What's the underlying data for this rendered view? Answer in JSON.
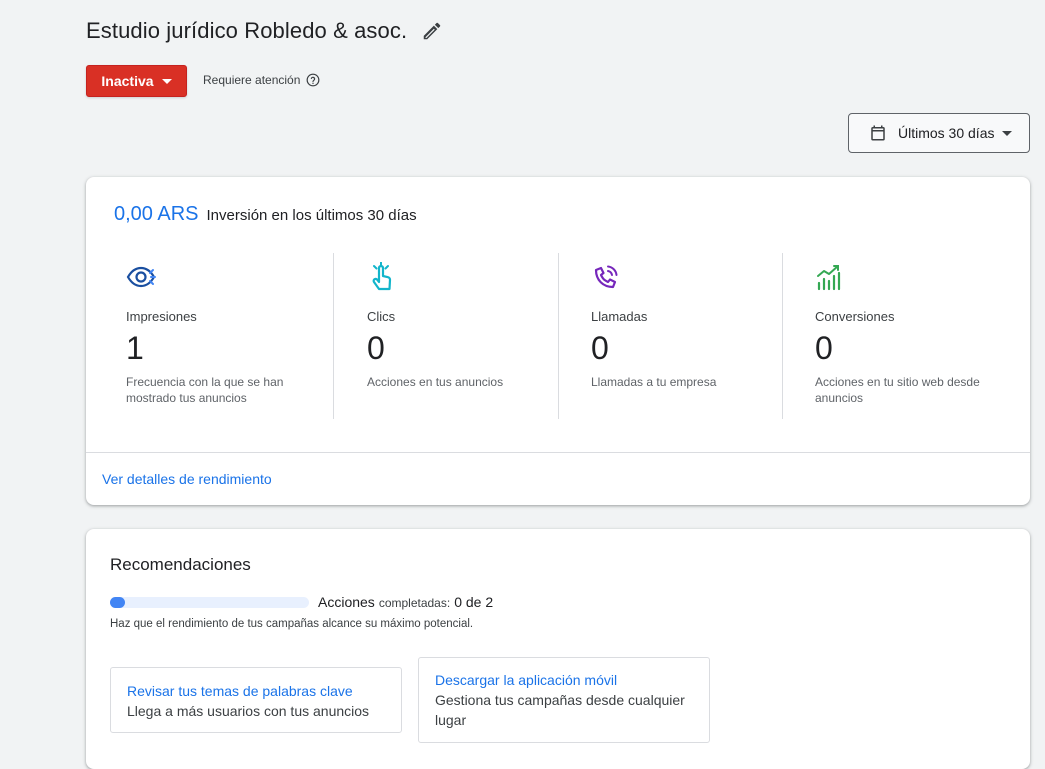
{
  "header": {
    "title": "Estudio jurídico Robledo & asoc.",
    "status_label": "Inactiva",
    "attention_text": "Requiere atención",
    "date_range_label": "Últimos 30 días"
  },
  "performance": {
    "spend_amount": "0,00 ARS",
    "spend_label": "Inversión en los últimos 30 días",
    "metrics": [
      {
        "icon": "eye-icon",
        "label": "Impresiones",
        "value": "1",
        "desc": "Frecuencia con la que se han mostrado tus anuncios",
        "color": "#1a4fa0"
      },
      {
        "icon": "tap-icon",
        "label": "Clics",
        "value": "0",
        "desc": "Acciones en tus anuncios",
        "color": "#12b5cb"
      },
      {
        "icon": "phone-call-icon",
        "label": "Llamadas",
        "value": "0",
        "desc": "Llamadas a tu empresa",
        "color": "#7627bb"
      },
      {
        "icon": "trend-chart-icon",
        "label": "Conversiones",
        "value": "0",
        "desc": "Acciones en tu sitio web desde anuncios",
        "color": "#34a853"
      }
    ],
    "details_link": "Ver detalles de rendimiento"
  },
  "recommendations": {
    "title": "Recomendaciones",
    "progress_fraction": 0.0,
    "progress_label_main": "Acciones",
    "progress_label_small": "completadas:",
    "progress_count": "0 de 2",
    "subtitle": "Haz que el rendimiento de tus campañas alcance su máximo potencial.",
    "tiles": [
      {
        "title": "Revisar tus temas de palabras clave",
        "desc": "Llega a más usuarios con tus anuncios"
      },
      {
        "title": "Descargar la aplicación móvil",
        "desc": "Gestiona tus campañas desde cualquier lugar"
      }
    ]
  },
  "colors": {
    "status_red": "#d93025",
    "link_blue": "#1a73e8",
    "progress_blue": "#4285f4"
  }
}
